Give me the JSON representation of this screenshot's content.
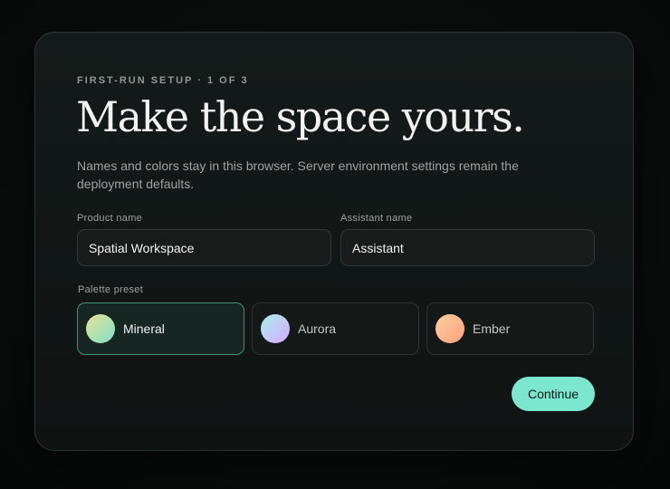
{
  "setup": {
    "eyebrow": "FIRST-RUN SETUP · 1 OF 3",
    "title": "Make the space yours.",
    "subtitle": "Names and colors stay in this browser. Server environment settings remain the deployment defaults."
  },
  "form": {
    "product_name_label": "Product name",
    "product_name_value": "Spatial Workspace",
    "assistant_name_label": "Assistant name",
    "assistant_name_value": "Assistant",
    "palette_label": "Palette preset",
    "palettes": [
      {
        "label": "Mineral",
        "selected": true,
        "gradient_from": "#e8e39a",
        "gradient_to": "#7fe0c6"
      },
      {
        "label": "Aurora",
        "selected": false,
        "gradient_from": "#a9f0ec",
        "gradient_to": "#d6a9ff"
      },
      {
        "label": "Ember",
        "selected": false,
        "gradient_from": "#ffd2a1",
        "gradient_to": "#ff9e7a"
      }
    ],
    "continue_label": "Continue"
  },
  "colors": {
    "accent": "#7de6cf",
    "selected_border": "#3f8f77"
  }
}
